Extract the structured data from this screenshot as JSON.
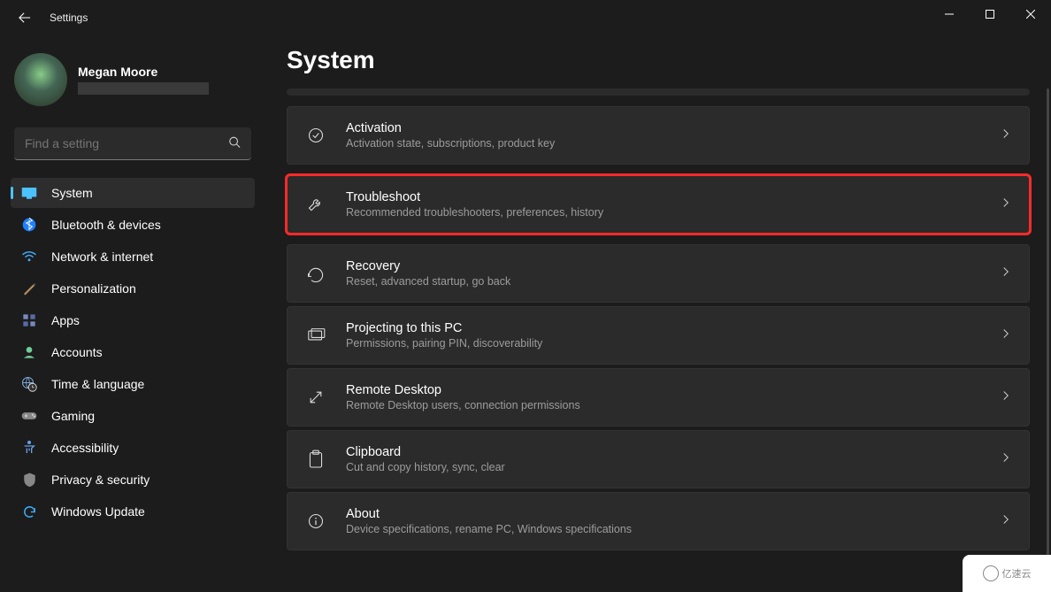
{
  "window": {
    "title": "Settings"
  },
  "user": {
    "name": "Megan Moore"
  },
  "search": {
    "placeholder": "Find a setting"
  },
  "nav": {
    "items": [
      {
        "label": "System",
        "icon": "monitor",
        "active": true
      },
      {
        "label": "Bluetooth & devices",
        "icon": "bluetooth"
      },
      {
        "label": "Network & internet",
        "icon": "wifi"
      },
      {
        "label": "Personalization",
        "icon": "brush"
      },
      {
        "label": "Apps",
        "icon": "apps"
      },
      {
        "label": "Accounts",
        "icon": "person"
      },
      {
        "label": "Time & language",
        "icon": "globe-clock"
      },
      {
        "label": "Gaming",
        "icon": "gamepad"
      },
      {
        "label": "Accessibility",
        "icon": "accessibility"
      },
      {
        "label": "Privacy & security",
        "icon": "shield"
      },
      {
        "label": "Windows Update",
        "icon": "sync"
      }
    ]
  },
  "page": {
    "title": "System"
  },
  "cards": [
    {
      "icon": "checkmark-circle",
      "title": "Activation",
      "desc": "Activation state, subscriptions, product key",
      "highlight": false
    },
    {
      "icon": "wrench",
      "title": "Troubleshoot",
      "desc": "Recommended troubleshooters, preferences, history",
      "highlight": true
    },
    {
      "icon": "recovery",
      "title": "Recovery",
      "desc": "Reset, advanced startup, go back",
      "highlight": false
    },
    {
      "icon": "project",
      "title": "Projecting to this PC",
      "desc": "Permissions, pairing PIN, discoverability",
      "highlight": false
    },
    {
      "icon": "remote",
      "title": "Remote Desktop",
      "desc": "Remote Desktop users, connection permissions",
      "highlight": false
    },
    {
      "icon": "clipboard",
      "title": "Clipboard",
      "desc": "Cut and copy history, sync, clear",
      "highlight": false
    },
    {
      "icon": "info",
      "title": "About",
      "desc": "Device specifications, rename PC, Windows specifications",
      "highlight": false
    }
  ],
  "watermark": {
    "text": "亿速云"
  }
}
